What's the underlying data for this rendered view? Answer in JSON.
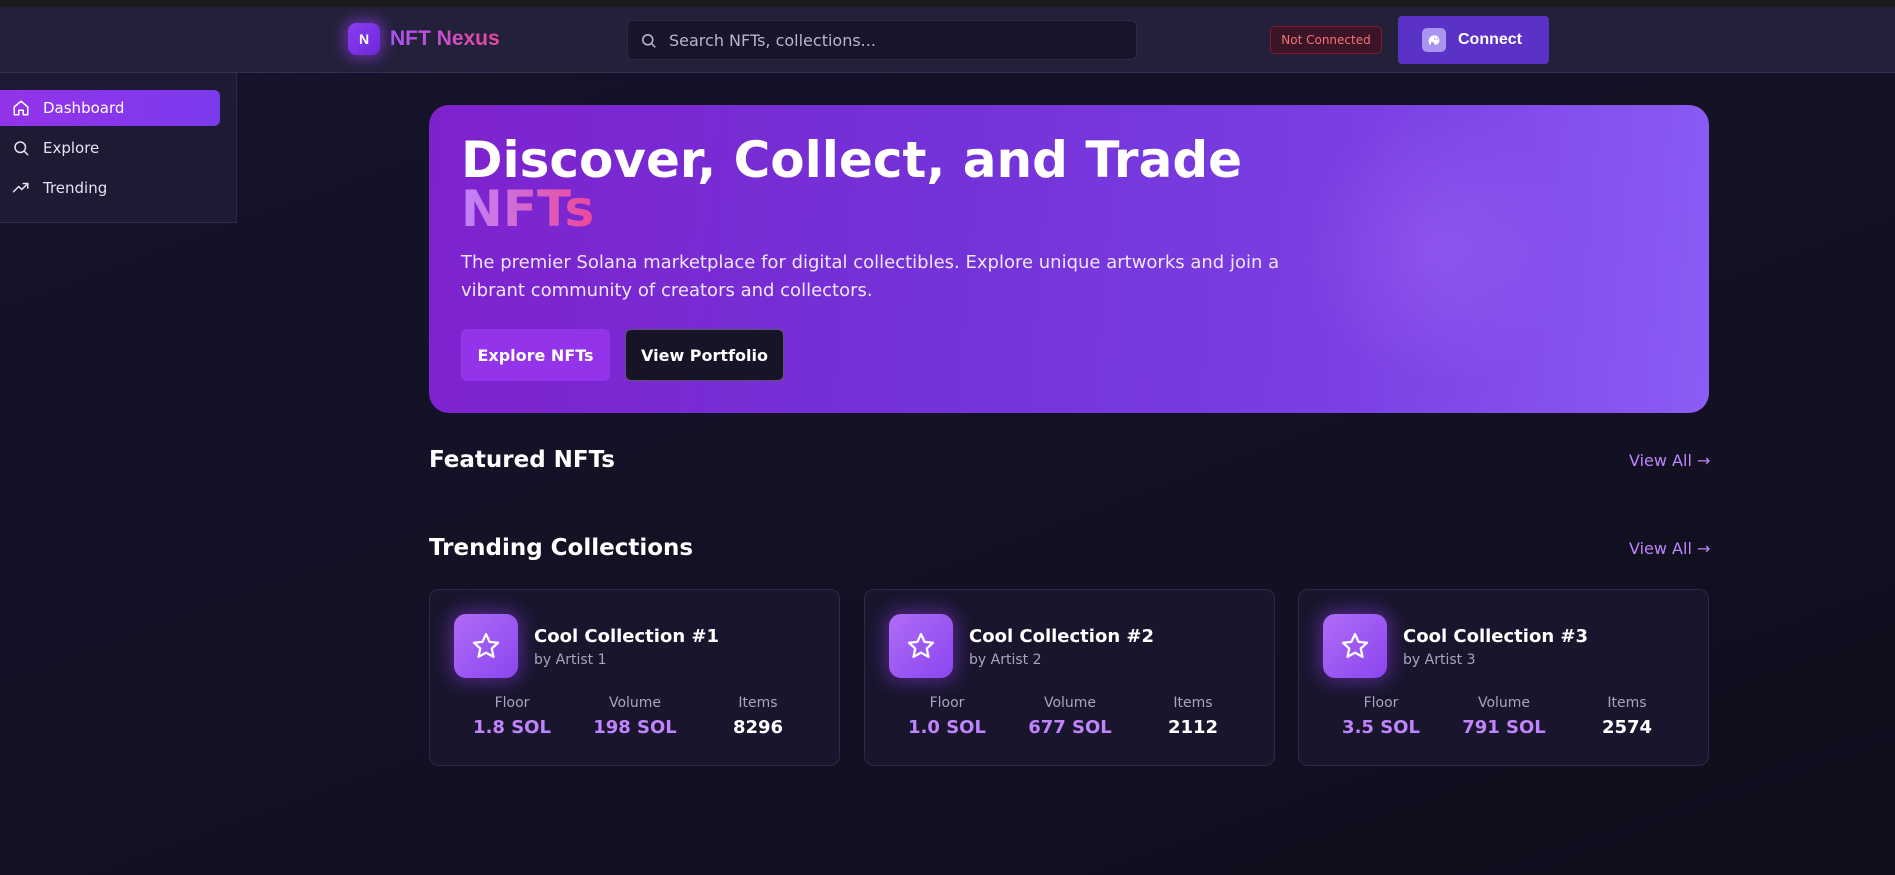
{
  "header": {
    "logo_letter": "N",
    "app_name": "NFT Nexus",
    "search_placeholder": "Search NFTs, collections...",
    "status": "Not Connected",
    "connect_label": "Connect"
  },
  "sidebar": {
    "items": [
      {
        "label": "Dashboard",
        "icon": "home-icon",
        "active": true
      },
      {
        "label": "Explore",
        "icon": "search-icon",
        "active": false
      },
      {
        "label": "Trending",
        "icon": "trending-up-icon",
        "active": false
      }
    ]
  },
  "hero": {
    "title": "Discover, Collect, and Trade",
    "title_accent": "NFTs",
    "subtitle": "The premier Solana marketplace for digital collectibles. Explore unique artworks and join a vibrant community of creators and collectors.",
    "primary_button": "Explore NFTs",
    "secondary_button": "View Portfolio"
  },
  "featured": {
    "title": "Featured NFTs",
    "view_all": "View All →"
  },
  "trending": {
    "title": "Trending Collections",
    "view_all": "View All →",
    "labels": {
      "floor": "Floor",
      "volume": "Volume",
      "items": "Items"
    },
    "collections": [
      {
        "name": "Cool Collection #1",
        "artist": "by Artist 1",
        "floor": "1.8 SOL",
        "volume": "198 SOL",
        "items": "8296",
        "icon": "star-icon"
      },
      {
        "name": "Cool Collection #2",
        "artist": "by Artist 2",
        "floor": "1.0 SOL",
        "volume": "677 SOL",
        "items": "2112",
        "icon": "star-icon"
      },
      {
        "name": "Cool Collection #3",
        "artist": "by Artist 3",
        "floor": "3.5 SOL",
        "volume": "791 SOL",
        "items": "2574",
        "icon": "star-icon"
      }
    ]
  },
  "colors": {
    "accent": "#9333ea",
    "accent_light": "#c084fc",
    "pink": "#ec4899",
    "background": "#141226"
  }
}
